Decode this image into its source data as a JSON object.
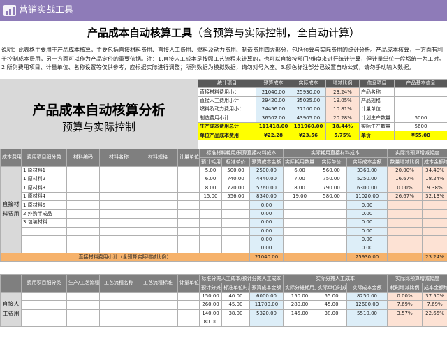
{
  "app": {
    "brand": "营销实战工具"
  },
  "header": {
    "title_main": "产品成本自动核算工具",
    "title_sub": "（含预算与实际控制，全自动计算）"
  },
  "description": "说明：此表格主要用于产品成本核算，主要包括直接材料费用、直接人工费用、燃料及动力费用、制造费用四大部分，包括预算与实际费用的统计分析。产品成本核算，一方面有利于控制成本费用，另一方面可以作为产品定价的重要依据。注：1.直接人工成本是按照工艺流程来计算的，也可以直接按部门/维度来进行统计计算，但计量单位一般都统一为工时。2.所列费用项目、计量单位、名称设置等仅供参考，应根据实际进行调整；所列数据为模拟数据，请勿对号入座。3.颜色标注部分已设置自动公式，请勿手动输入数据。",
  "analysis": {
    "title": "产品成本自动核算分析",
    "subtitle": "预算与实际控制"
  },
  "summary": {
    "headers": [
      "统计项目",
      "预算成本",
      "实际成本",
      "增减比例"
    ],
    "rows": [
      [
        "直接材料费用小计",
        "21040.00",
        "25930.00",
        "23.24%"
      ],
      [
        "直接人工费用小计",
        "29420.00",
        "35025.00",
        "19.05%"
      ],
      [
        "燃料及动力费用小计",
        "24456.00",
        "27100.00",
        "10.81%"
      ],
      [
        "制造费用小计",
        "36502.00",
        "43905.00",
        "20.28%"
      ]
    ],
    "total": [
      "生产成本费用总计",
      "111418.00",
      "131960.00",
      "18.44%"
    ],
    "unit": [
      "单位产品成本费用",
      "¥22.28",
      "¥23.56",
      "5.75%"
    ]
  },
  "info": {
    "headers": [
      "信息项目",
      "产品基本信息"
    ],
    "rows": [
      [
        "产品名称",
        ""
      ],
      [
        "产品规格",
        ""
      ],
      [
        "计量单位",
        ""
      ],
      [
        "计划生产数量",
        "5000"
      ],
      [
        "实际生产数量",
        "5600"
      ],
      [
        "单价",
        "¥55.00"
      ]
    ]
  },
  "material": {
    "side_header": "成本费用项目大类",
    "group_label": "直接材料费用",
    "headers_top": [
      "费用项目细分类",
      "材料编码",
      "材料名称",
      "材料规格",
      "计量单位",
      "标准材料耗用/预算直接材料成本",
      "实际耗用直接材料成本",
      "实际比预算增减幅度"
    ],
    "headers_sub": [
      "预计耗用数量",
      "标准单价",
      "预算成本金额",
      "实际耗用数量",
      "实际单价",
      "实际成本金额",
      "数量增减比例",
      "成本金额增减比例"
    ],
    "rows": [
      [
        "1.原材料1",
        "",
        "",
        "",
        "",
        "5.00",
        "500.00",
        "2500.00",
        "6.00",
        "560.00",
        "3360.00",
        "20.00%",
        "34.40%"
      ],
      [
        "1.原材料2",
        "",
        "",
        "",
        "",
        "6.00",
        "740.00",
        "4440.00",
        "7.00",
        "750.00",
        "5250.00",
        "16.67%",
        "18.24%"
      ],
      [
        "1.原材料3",
        "",
        "",
        "",
        "",
        "8.00",
        "720.00",
        "5760.00",
        "8.00",
        "790.00",
        "6300.00",
        "0.00%",
        "9.38%"
      ],
      [
        "1.原材料4",
        "",
        "",
        "",
        "",
        "15.00",
        "556.00",
        "8340.00",
        "19.00",
        "580.00",
        "11020.00",
        "26.67%",
        "32.13%"
      ],
      [
        "1.原材料5",
        "",
        "",
        "",
        "",
        "",
        "",
        "0.00",
        "",
        "",
        "0.00",
        "",
        ""
      ],
      [
        "2.外购半成品",
        "",
        "",
        "",
        "",
        "",
        "",
        "0.00",
        "",
        "",
        "0.00",
        "",
        ""
      ],
      [
        "3.包装材料",
        "",
        "",
        "",
        "",
        "",
        "",
        "0.00",
        "",
        "",
        "0.00",
        "",
        ""
      ],
      [
        "",
        "",
        "",
        "",
        "",
        "",
        "",
        "0.00",
        "",
        "",
        "0.00",
        "",
        ""
      ],
      [
        "",
        "",
        "",
        "",
        "",
        "",
        "",
        "0.00",
        "",
        "",
        "0.00",
        "",
        ""
      ],
      [
        "",
        "",
        "",
        "",
        "",
        "",
        "",
        "0.00",
        "",
        "",
        "0.00",
        "",
        ""
      ]
    ],
    "subtotal": [
      "直接材料费用小计（含预算实际增减比例）",
      "21040.00",
      "25930.00",
      "23.24%"
    ]
  },
  "labor": {
    "group_label": "直接人工费用",
    "headers_top": [
      "费用项目细分类",
      "生产/工艺流程编号",
      "工艺流程名称",
      "工艺流程标准",
      "计量单位（工时）",
      "标准分摊人工成本/预计分摊人工成本",
      "实际分摊人工成本",
      "实际比预算增减幅度"
    ],
    "headers_sub": [
      "预计分摊耗时",
      "标准单位时成本",
      "预算成本金额",
      "实际分摊耗用工时",
      "实际单位时成本",
      "实际成本金额",
      "耗时增减比例",
      "成本金额增减比例"
    ],
    "rows": [
      [
        "",
        "",
        "",
        "",
        "",
        "150.00",
        "40.00",
        "6000.00",
        "150.00",
        "55.00",
        "8250.00",
        "0.00%",
        "37.50%"
      ],
      [
        "",
        "",
        "",
        "",
        "",
        "260.00",
        "45.00",
        "11700.00",
        "280.00",
        "45.00",
        "12600.00",
        "7.69%",
        "7.69%"
      ],
      [
        "",
        "",
        "",
        "",
        "",
        "140.00",
        "38.00",
        "5320.00",
        "145.00",
        "38.00",
        "5510.00",
        "3.57%",
        "22.65%"
      ],
      [
        "",
        "",
        "",
        "",
        "",
        "80.00",
        "",
        "",
        "",
        "",
        "",
        "",
        ""
      ]
    ]
  }
}
